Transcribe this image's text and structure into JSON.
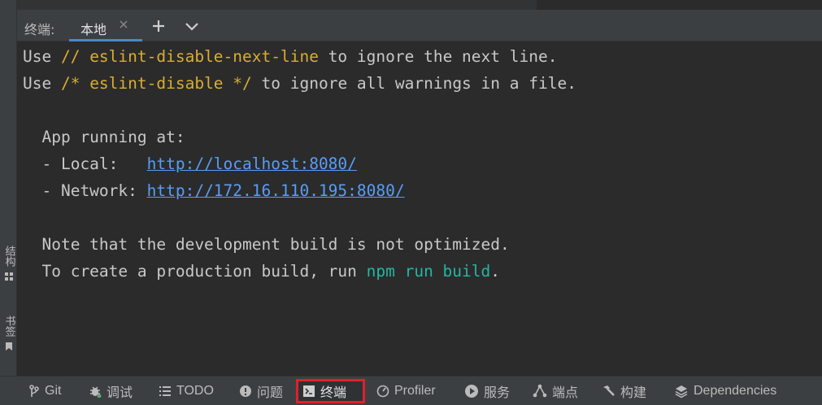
{
  "tool_window": {
    "title": "终端:",
    "tabs": [
      {
        "label": "本地",
        "active": true
      }
    ],
    "add_icon": "plus-icon",
    "more_icon": "chevron-down-icon"
  },
  "terminal": {
    "lines": [
      [
        {
          "t": "Use "
        },
        {
          "t": "// eslint-disable-next-line",
          "c": "hl"
        },
        {
          "t": " to ignore the next line."
        }
      ],
      [
        {
          "t": "Use "
        },
        {
          "t": "/* eslint-disable */",
          "c": "hl"
        },
        {
          "t": " to ignore all warnings in a file."
        }
      ],
      [],
      [
        {
          "t": "  App running at:"
        }
      ],
      [
        {
          "t": "  - Local:   "
        },
        {
          "t": "http://localhost:8080/",
          "c": "lnk"
        }
      ],
      [
        {
          "t": "  - Network: "
        },
        {
          "t": "http://172.16.110.195:8080/",
          "c": "lnk"
        }
      ],
      [],
      [
        {
          "t": "  Note that the development build is not optimized."
        }
      ],
      [
        {
          "t": "  To create a production build, run "
        },
        {
          "t": "npm run build",
          "c": "grn"
        },
        {
          "t": "."
        }
      ]
    ]
  },
  "left_sidebar": [
    {
      "label": "结构",
      "icon": "structure-icon"
    },
    {
      "label": "书签",
      "icon": "bookmark-icon"
    }
  ],
  "bottom_bar": [
    {
      "label": "Git",
      "icon": "git-branch-icon"
    },
    {
      "label": "调试",
      "icon": "bug-icon"
    },
    {
      "label": "TODO",
      "icon": "list-icon"
    },
    {
      "label": "问题",
      "icon": "info-icon"
    },
    {
      "label": "终端",
      "icon": "terminal-icon",
      "active": true
    },
    {
      "label": "Profiler",
      "icon": "profiler-icon"
    },
    {
      "label": "服务",
      "icon": "play-icon"
    },
    {
      "label": "端点",
      "icon": "endpoints-icon"
    },
    {
      "label": "构建",
      "icon": "hammer-icon"
    },
    {
      "label": "Dependencies",
      "icon": "layers-icon"
    }
  ],
  "colors": {
    "background": "#2b2b2b",
    "panel": "#3c3f41",
    "keyword_hint": "#d8ad34",
    "command": "#25b6a0",
    "link": "#589df6",
    "active_highlight": "#e0202a",
    "tab_underline": "#4a88c7"
  }
}
